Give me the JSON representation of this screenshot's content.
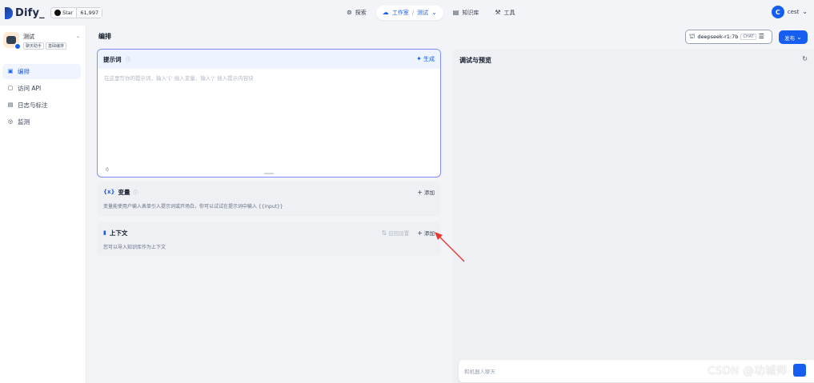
{
  "app": {
    "logo_text": "Dify_"
  },
  "github": {
    "star_label": "Star",
    "star_count": "61,997"
  },
  "nav": {
    "explore": "探索",
    "studio": "工作室",
    "studio_sep": "/",
    "studio_app": "测试",
    "knowledge": "知识库",
    "tools": "工具"
  },
  "user": {
    "initial": "C",
    "name": "cest"
  },
  "sidebar": {
    "app_name": "测试",
    "tags": [
      "聊天助手",
      "基础编排"
    ],
    "items": [
      {
        "label": "编排",
        "icon": "orchestrate-icon",
        "active": true
      },
      {
        "label": "访问 API",
        "icon": "api-icon",
        "active": false
      },
      {
        "label": "日志与标注",
        "icon": "logs-icon",
        "active": false
      },
      {
        "label": "监测",
        "icon": "monitor-icon",
        "active": false
      }
    ]
  },
  "main": {
    "title": "编排",
    "model": {
      "name": "deepseek-r1:7b",
      "tag": "CHAT"
    },
    "publish_label": "发布"
  },
  "prompt": {
    "title": "提示词",
    "generate_label": "生成",
    "placeholder": "在这里写你的提示词，输入'{' 插入变量、输入'/' 插入提示内容块",
    "char_count": "0"
  },
  "variables": {
    "title": "变量",
    "add_label": "添加",
    "description": "变量能使用户输入表单引入提示词或开场白，你可以试试在提示词中输入 {{input}}"
  },
  "context": {
    "title": "上下文",
    "recall_label": "召回设置",
    "add_label": "添加",
    "description": "您可以导入知识库作为上下文"
  },
  "preview": {
    "title": "调试与预览",
    "chat_placeholder": "和机器人聊天"
  },
  "watermark": "CSDN @功城师",
  "colors": {
    "accent": "#155eef",
    "annotation_arrow": "#e53935"
  }
}
